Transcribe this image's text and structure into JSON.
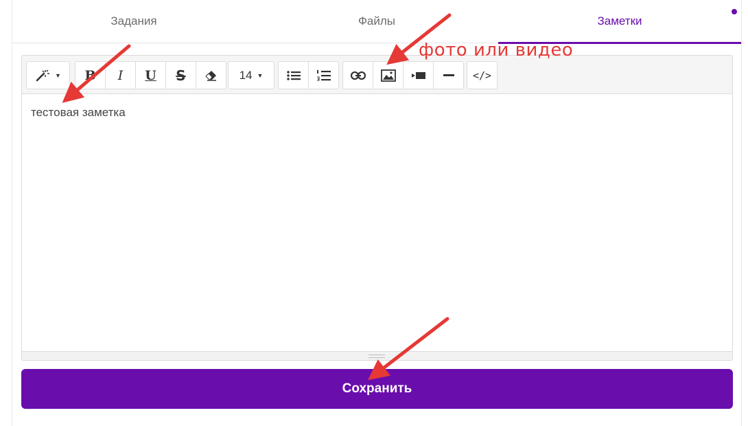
{
  "tabs": [
    {
      "label": "Задания",
      "active": false
    },
    {
      "label": "Файлы",
      "active": false
    },
    {
      "label": "Заметки",
      "active": true
    }
  ],
  "notification_dot_color": "#6a0dad",
  "toolbar": {
    "style_icon": "magic-wand-icon",
    "format_buttons": [
      {
        "name": "bold",
        "label": "B"
      },
      {
        "name": "italic",
        "label": "I"
      },
      {
        "name": "underline",
        "label": "U"
      },
      {
        "name": "strikethrough",
        "label": "S"
      },
      {
        "name": "eraser",
        "icon": "eraser-icon"
      }
    ],
    "font_size": "14",
    "list_icons": [
      "bulleted-list-icon",
      "numbered-list-icon"
    ],
    "insert_icons": [
      "link-icon",
      "image-icon",
      "video-icon",
      "horizontal-rule-icon"
    ],
    "code_view_label": "</>"
  },
  "editor": {
    "content": "тестовая заметка"
  },
  "save_button": {
    "label": "Сохранить"
  },
  "annotation": {
    "label": "фото или видео"
  },
  "colors": {
    "accent": "#6a0dad",
    "annotation": "#e53935"
  }
}
